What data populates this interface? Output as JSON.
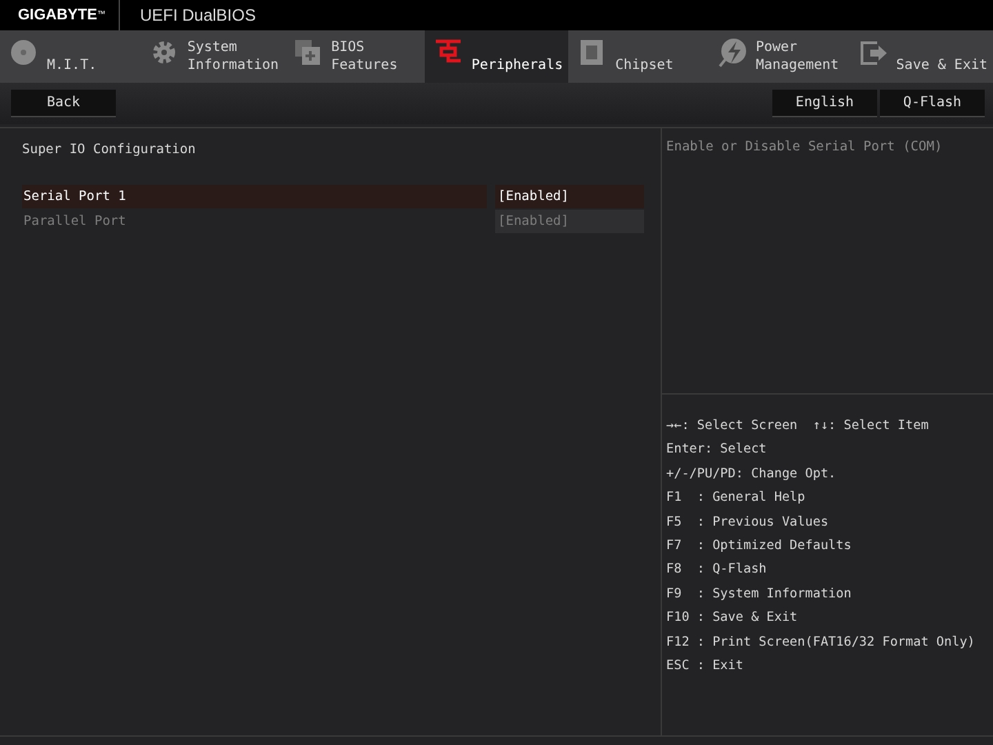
{
  "header": {
    "brand": "GIGABYTE",
    "brand_mark": "™",
    "product": "UEFI DualBIOS"
  },
  "tabs": [
    {
      "kind": "disc",
      "lines": [
        "M.I.T."
      ],
      "selected": false
    },
    {
      "kind": "gear",
      "lines": [
        "System",
        "Information"
      ],
      "selected": false
    },
    {
      "kind": "stack",
      "lines": [
        "BIOS",
        "Features"
      ],
      "selected": false
    },
    {
      "kind": "plug",
      "lines": [
        "Peripherals"
      ],
      "selected": true
    },
    {
      "kind": "chip",
      "lines": [
        "Chipset"
      ],
      "selected": false
    },
    {
      "kind": "bolt",
      "lines": [
        "Power",
        "Management"
      ],
      "selected": false
    },
    {
      "kind": "exit",
      "lines": [
        "Save & Exit"
      ],
      "selected": false
    }
  ],
  "toolbar": {
    "left": [
      "Back"
    ],
    "right": [
      "English",
      "Q-Flash"
    ]
  },
  "page": {
    "title": "Super IO Configuration",
    "items": [
      {
        "label": "Serial Port 1",
        "value": "[Enabled]",
        "selected": true,
        "disabled": false
      },
      {
        "label": "Parallel Port",
        "value": "[Enabled]",
        "selected": false,
        "disabled": true
      }
    ]
  },
  "help": {
    "description": "Enable or Disable Serial Port (COM)",
    "keys": [
      "→←: Select Screen  ↑↓: Select Item",
      "Enter: Select",
      "+/-/PU/PD: Change Opt.",
      "F1  : General Help",
      "F5  : Previous Values",
      "F7  : Optimized Defaults",
      "F8  : Q-Flash",
      "F9  : System Information",
      "F10 : Save & Exit",
      "F12 : Print Screen(FAT16/32 Format Only)",
      "ESC : Exit"
    ]
  }
}
